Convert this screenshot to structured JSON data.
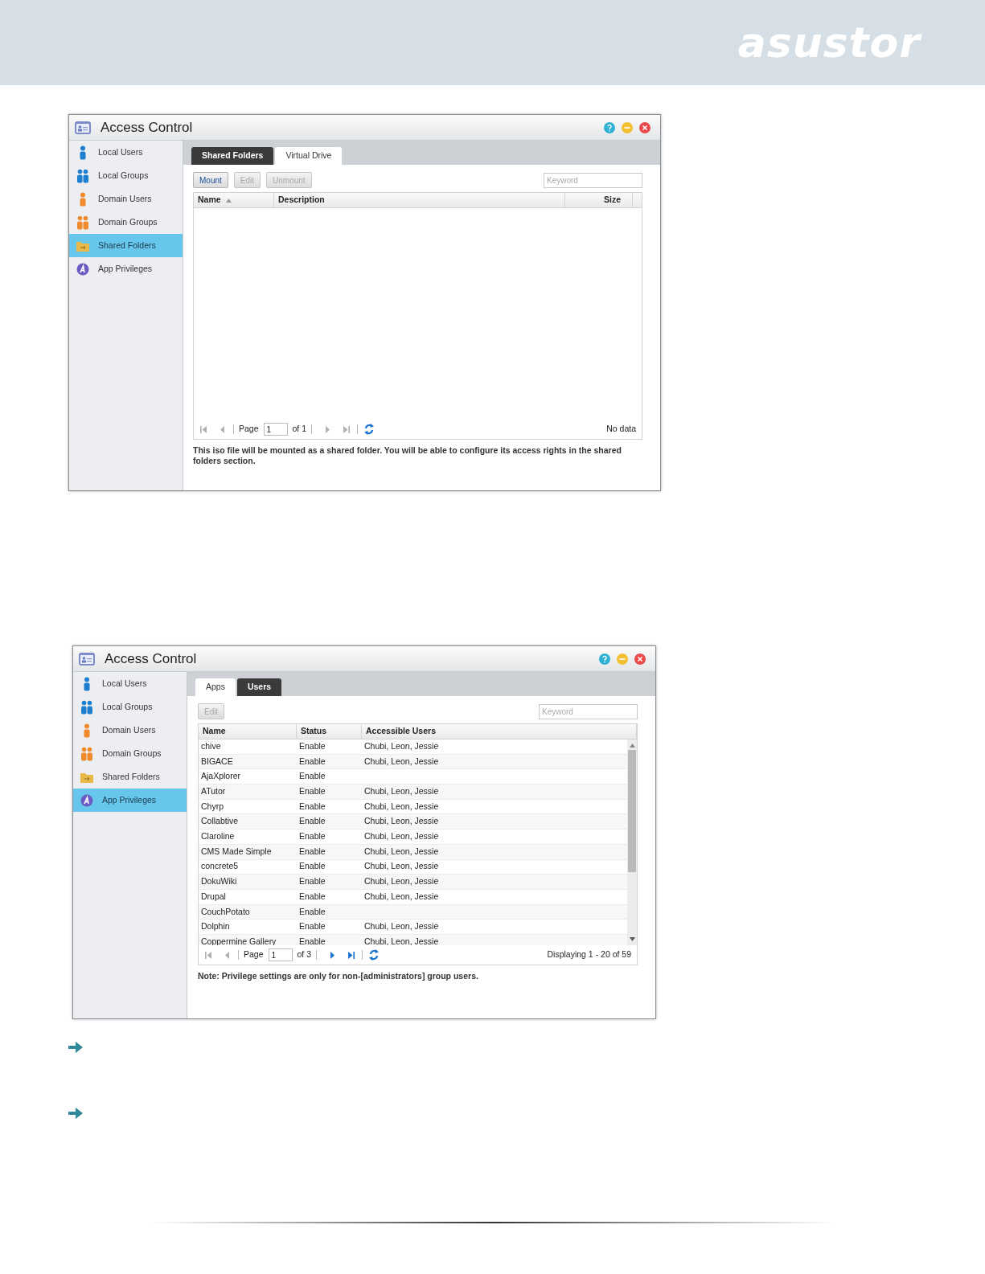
{
  "header": {
    "logo": "asustor"
  },
  "windows": [
    {
      "title": "Access Control",
      "sidebar": [
        {
          "label": "Local Users",
          "kind": "user",
          "color": "#1e7fd0",
          "selected": false
        },
        {
          "label": "Local Groups",
          "kind": "group",
          "color": "#1e7fd0",
          "selected": false
        },
        {
          "label": "Domain Users",
          "kind": "user",
          "color": "#f08a2c",
          "selected": false
        },
        {
          "label": "Domain Groups",
          "kind": "group",
          "color": "#f08a2c",
          "selected": false
        },
        {
          "label": "Shared Folders",
          "kind": "folder",
          "color": "#e8b84a",
          "selected": true
        },
        {
          "label": "App Privileges",
          "kind": "app",
          "color": "#6a5cc4",
          "selected": false
        }
      ],
      "tabs": [
        {
          "label": "Shared Folders",
          "selected": false
        },
        {
          "label": "Virtual Drive",
          "selected": true
        }
      ],
      "buttons": [
        {
          "label": "Mount",
          "disabled": false
        },
        {
          "label": "Edit",
          "disabled": true
        },
        {
          "label": "Unmount",
          "disabled": true
        }
      ],
      "search": {
        "placeholder": "Keyword"
      },
      "columns": [
        {
          "label": "Name",
          "sorted": true
        },
        {
          "label": "Description",
          "sorted": false
        },
        {
          "label": "Size",
          "sorted": false
        }
      ],
      "pager": {
        "label": "Page",
        "value": "1",
        "total": "of 1",
        "status": "No data",
        "back_enabled": false,
        "forward_enabled": false
      },
      "note": "This iso file will be mounted as a shared folder. You will be able to configure its access rights in the shared folders section."
    },
    {
      "title": "Access Control",
      "sidebar": [
        {
          "label": "Local Users",
          "kind": "user",
          "color": "#1e7fd0",
          "selected": false
        },
        {
          "label": "Local Groups",
          "kind": "group",
          "color": "#1e7fd0",
          "selected": false
        },
        {
          "label": "Domain Users",
          "kind": "user",
          "color": "#f08a2c",
          "selected": false
        },
        {
          "label": "Domain Groups",
          "kind": "group",
          "color": "#f08a2c",
          "selected": false
        },
        {
          "label": "Shared Folders",
          "kind": "folder",
          "color": "#e8b84a",
          "selected": false
        },
        {
          "label": "App Privileges",
          "kind": "app",
          "color": "#6a5cc4",
          "selected": true
        }
      ],
      "tabs": [
        {
          "label": "Apps",
          "selected": true
        },
        {
          "label": "Users",
          "selected": false
        }
      ],
      "buttons": [
        {
          "label": "Edit",
          "disabled": true
        }
      ],
      "search": {
        "placeholder": "Keyword"
      },
      "columns": [
        {
          "label": "Name",
          "sorted": false
        },
        {
          "label": "Status",
          "sorted": false
        },
        {
          "label": "Accessible Users",
          "sorted": false
        }
      ],
      "rows": [
        [
          "chive",
          "Enable",
          "Chubi, Leon, Jessie"
        ],
        [
          "BIGACE",
          "Enable",
          "Chubi, Leon, Jessie"
        ],
        [
          "AjaXplorer",
          "Enable",
          ""
        ],
        [
          "ATutor",
          "Enable",
          "Chubi, Leon, Jessie"
        ],
        [
          "Chyrp",
          "Enable",
          "Chubi, Leon, Jessie"
        ],
        [
          "Collabtive",
          "Enable",
          "Chubi, Leon, Jessie"
        ],
        [
          "Claroline",
          "Enable",
          "Chubi, Leon, Jessie"
        ],
        [
          "CMS Made Simple",
          "Enable",
          "Chubi, Leon, Jessie"
        ],
        [
          "concrete5",
          "Enable",
          "Chubi, Leon, Jessie"
        ],
        [
          "DokuWiki",
          "Enable",
          "Chubi, Leon, Jessie"
        ],
        [
          "Drupal",
          "Enable",
          "Chubi, Leon, Jessie"
        ],
        [
          "CouchPotato",
          "Enable",
          ""
        ],
        [
          "Dolphin",
          "Enable",
          "Chubi, Leon, Jessie"
        ],
        [
          "Coppermine Gallery",
          "Enable",
          "Chubi, Leon, Jessie"
        ]
      ],
      "pager": {
        "label": "Page",
        "value": "1",
        "total": "of 3",
        "status": "Displaying 1 - 20 of 59",
        "back_enabled": false,
        "forward_enabled": true
      },
      "note": "Note: Privilege settings are only for non-[administrators] group users."
    }
  ]
}
